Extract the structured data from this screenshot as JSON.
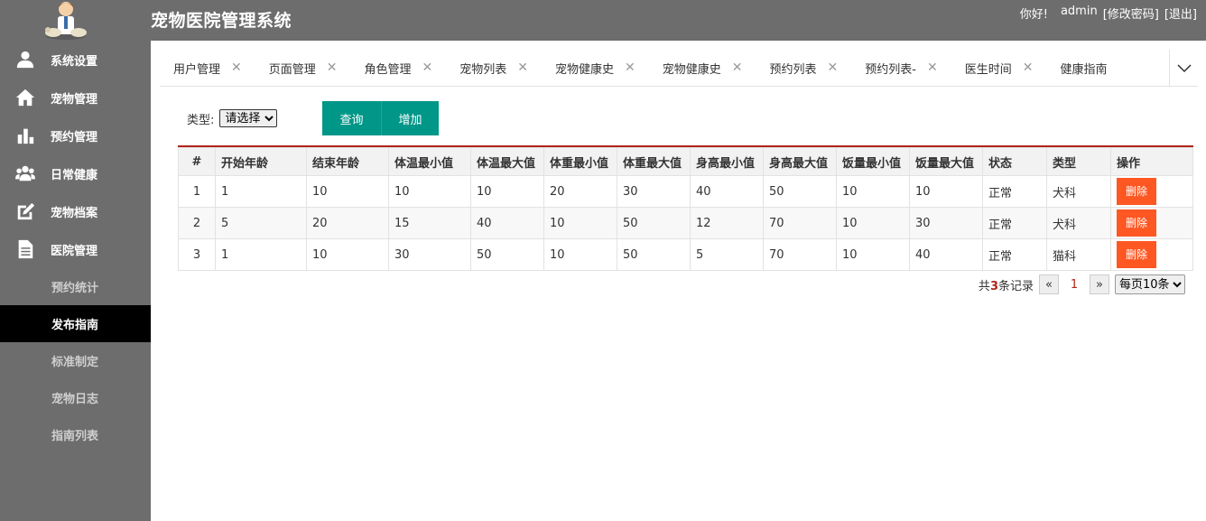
{
  "app": {
    "title": "宠物医院管理系统"
  },
  "user": {
    "greeting": "你好!",
    "name": "admin",
    "change_password": "[修改密码]",
    "logout": "[退出]"
  },
  "sidebar": {
    "items": [
      {
        "label": "系统设置",
        "icon": "user-icon"
      },
      {
        "label": "宠物管理",
        "icon": "home-icon"
      },
      {
        "label": "预约管理",
        "icon": "bar-chart-icon"
      },
      {
        "label": "日常健康",
        "icon": "group-icon"
      },
      {
        "label": "宠物档案",
        "icon": "edit-icon"
      },
      {
        "label": "医院管理",
        "icon": "document-icon"
      }
    ],
    "subitems": [
      {
        "label": "预约统计"
      },
      {
        "label": "发布指南",
        "active": true
      },
      {
        "label": "标准制定"
      },
      {
        "label": "宠物日志"
      },
      {
        "label": "指南列表"
      }
    ]
  },
  "tabs": [
    {
      "label": "用户管理"
    },
    {
      "label": "页面管理"
    },
    {
      "label": "角色管理"
    },
    {
      "label": "宠物列表"
    },
    {
      "label": "宠物健康史"
    },
    {
      "label": "宠物健康史"
    },
    {
      "label": "预约列表"
    },
    {
      "label": "预约列表-"
    },
    {
      "label": "医生时间"
    },
    {
      "label": "健康指南"
    }
  ],
  "filter": {
    "type_label": "类型:",
    "type_selected": "请选择",
    "query_label": "查询",
    "add_label": "增加"
  },
  "table": {
    "headers": [
      "#",
      "开始年龄",
      "结束年龄",
      "体温最小值",
      "体温最大值",
      "体重最小值",
      "体重最大值",
      "身高最小值",
      "身高最大值",
      "饭量最小值",
      "饭量最大值",
      "状态",
      "类型",
      "操作"
    ],
    "rows": [
      [
        "1",
        "1",
        "10",
        "10",
        "10",
        "20",
        "30",
        "40",
        "50",
        "10",
        "10",
        "正常",
        "犬科"
      ],
      [
        "2",
        "5",
        "20",
        "15",
        "40",
        "10",
        "50",
        "12",
        "70",
        "10",
        "30",
        "正常",
        "犬科"
      ],
      [
        "3",
        "1",
        "10",
        "30",
        "50",
        "10",
        "50",
        "5",
        "70",
        "10",
        "40",
        "正常",
        "猫科"
      ]
    ],
    "delete_label": "删除"
  },
  "pager": {
    "total_prefix": "共",
    "total_count": "3",
    "total_suffix": "条记录",
    "prev": "«",
    "current": "1",
    "next": "»",
    "per_page": "每页10条"
  },
  "colors": {
    "header_bg": "#6d6d6d",
    "accent_green": "#009688",
    "danger": "#ff5722",
    "table_top_border": "#b0251b"
  }
}
